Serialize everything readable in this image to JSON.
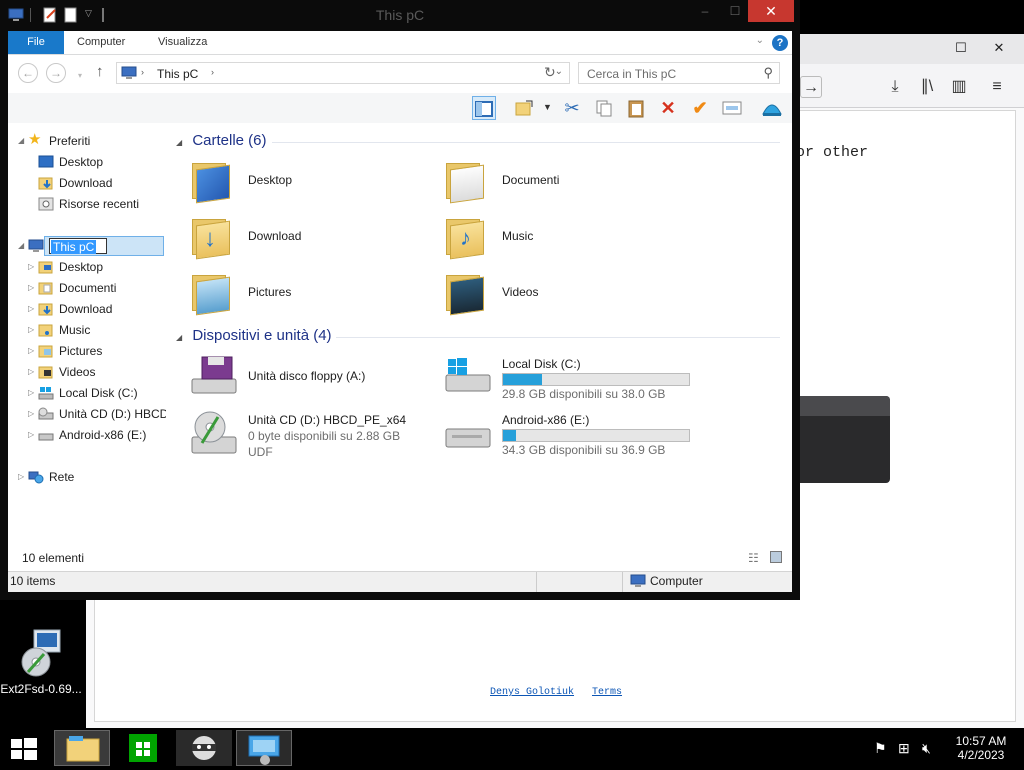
{
  "explorer": {
    "window_title": "This pC",
    "ribbon": {
      "file": "File",
      "computer": "Computer",
      "view": "Visualizza",
      "help": "?"
    },
    "address": {
      "location": "This pC",
      "search_placeholder": "Cerca in This pC"
    },
    "nav": {
      "favorites": "Preferiti",
      "fav_items": [
        "Desktop",
        "Download",
        "Risorse recenti"
      ],
      "this_pc": "This pC",
      "pc_items": [
        "Desktop",
        "Documenti",
        "Download",
        "Music",
        "Pictures",
        "Videos",
        "Local Disk (C:)",
        "Unità CD (D:) HBCD_",
        "Android-x86 (E:)"
      ],
      "network": "Rete"
    },
    "groups": {
      "folders": "Cartelle (6)",
      "devices": "Dispositivi e unità (4)"
    },
    "folders": [
      "Desktop",
      "Documenti",
      "Download",
      "Music",
      "Pictures",
      "Videos"
    ],
    "drives": [
      {
        "name": "Unità disco floppy (A:)"
      },
      {
        "name": "Local Disk (C:)",
        "free": "29.8 GB disponibili su 38.0 GB",
        "used_fraction": 0.21
      },
      {
        "name": "Unità CD (D:) HBCD_PE_x64",
        "free": "0 byte disponibili su 2.88 GB",
        "fs": "UDF"
      },
      {
        "name": "Android-x86 (E:)",
        "free": "34.3 GB disponibili su 36.9 GB",
        "used_fraction": 0.07
      }
    ],
    "item_count": "10 elementi",
    "status": {
      "items": "10 items",
      "location": "Computer"
    }
  },
  "browser": {
    "text_fragment": "or other",
    "footer_links": [
      "Denys Golotiuk",
      "Terms"
    ]
  },
  "desktop": {
    "icon_label": "Ext2Fsd-0.69..."
  },
  "taskbar": {
    "time": "10:57 AM",
    "date": "4/2/2023"
  },
  "colors": {
    "accent": "#1979ca",
    "close": "#c7372f",
    "drive_bar": "#26a0da",
    "group_heading": "#1e3287"
  }
}
